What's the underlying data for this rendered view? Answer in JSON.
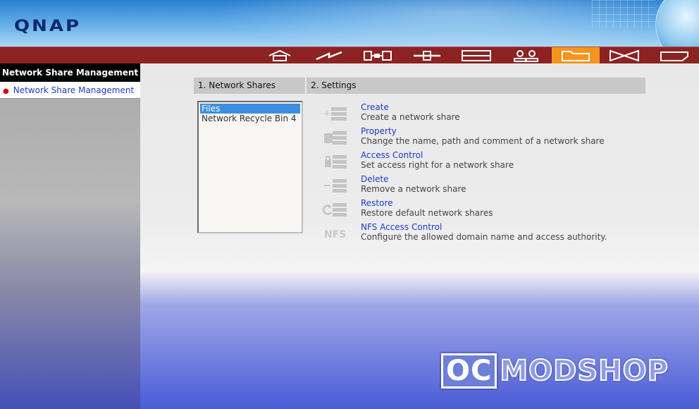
{
  "brand": {
    "logo": "QNAP"
  },
  "toolbar": {
    "items": [
      {
        "icon": "home-icon"
      },
      {
        "icon": "lightning-icon"
      },
      {
        "icon": "network-icon"
      },
      {
        "icon": "plus-icon"
      },
      {
        "icon": "storage-icon"
      },
      {
        "icon": "users-icon"
      },
      {
        "icon": "folder-icon",
        "active": true
      },
      {
        "icon": "bowtie-icon"
      },
      {
        "icon": "tag-icon"
      }
    ],
    "colors": {
      "bar": "#8c2222",
      "active": "#f7941d"
    }
  },
  "sidebar": {
    "title": "Network Share Management",
    "items": [
      {
        "label": "Network Share Management"
      }
    ]
  },
  "main": {
    "network_shares": {
      "header": "1. Network Shares",
      "items": [
        "Files",
        "Network Recycle Bin 4"
      ],
      "selected": "Files"
    },
    "settings": {
      "header": "2. Settings",
      "items": [
        {
          "icon": "create-share-icon",
          "label": "Create",
          "description": "Create a network share"
        },
        {
          "icon": "property-icon",
          "label": "Property",
          "description": "Change the name, path and comment of a network share"
        },
        {
          "icon": "access-control-icon",
          "label": "Access Control",
          "description": "Set access right for a network share"
        },
        {
          "icon": "delete-share-icon",
          "label": "Delete",
          "description": "Remove a network share"
        },
        {
          "icon": "restore-icon",
          "label": "Restore",
          "description": "Restore default network shares"
        },
        {
          "icon": "nfs-icon",
          "label": "NFS Access Control",
          "description": "Configure the allowed domain name and access authority.",
          "icon_text": "NFS"
        }
      ]
    }
  },
  "watermark": {
    "part1": "OC",
    "part2": "MODSHOP"
  }
}
